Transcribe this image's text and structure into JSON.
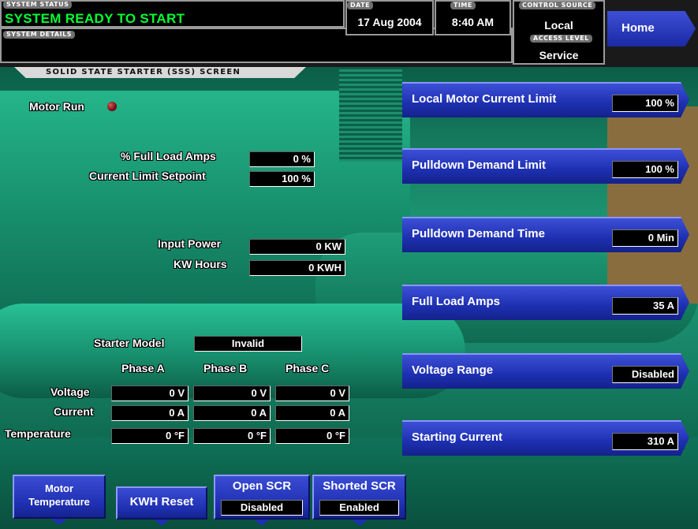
{
  "header": {
    "system_status_tag": "SYSTEM STATUS",
    "system_status": "SYSTEM READY TO START",
    "system_details_tag": "SYSTEM DETAILS",
    "system_details": "",
    "date_tag": "DATE",
    "date": "17 Aug 2004",
    "time_tag": "TIME",
    "time": "8:40 AM",
    "control_source_tag": "CONTROL SOURCE",
    "control_source": "Local",
    "access_level_tag": "ACCESS LEVEL",
    "access_level": "Service",
    "home_label": "Home"
  },
  "screen_title": "SOLID STATE STARTER (SSS) SCREEN",
  "motor_run": {
    "label": "Motor Run",
    "indicator_color": "#7a0c12"
  },
  "readings": {
    "full_load_amps_pct": {
      "label": "% Full Load Amps",
      "value": "0 %"
    },
    "current_limit_setpoint": {
      "label": "Current Limit Setpoint",
      "value": "100 %"
    },
    "input_power": {
      "label": "Input Power",
      "value": "0 KW"
    },
    "kw_hours": {
      "label": "KW Hours",
      "value": "0 KWH"
    },
    "starter_model": {
      "label": "Starter Model",
      "value": "Invalid"
    }
  },
  "phase_table": {
    "headers": [
      "Phase A",
      "Phase B",
      "Phase C"
    ],
    "rows": [
      {
        "label": "Voltage",
        "values": [
          "0 V",
          "0 V",
          "0 V"
        ]
      },
      {
        "label": "Current",
        "values": [
          "0 A",
          "0 A",
          "0 A"
        ]
      },
      {
        "label": "Temperature",
        "values": [
          "0 °F",
          "0 °F",
          "0 °F"
        ]
      }
    ]
  },
  "setpoints": [
    {
      "label": "Local Motor Current Limit",
      "value": "100 %"
    },
    {
      "label": "Pulldown Demand Limit",
      "value": "100 %"
    },
    {
      "label": "Pulldown Demand Time",
      "value": "0 Min"
    },
    {
      "label": "Full Load Amps",
      "value": "35 A"
    },
    {
      "label": "Voltage Range",
      "value": "Disabled"
    },
    {
      "label": "Starting Current",
      "value": "310 A"
    }
  ],
  "bottom_buttons": {
    "motor_temperature": {
      "line1": "Motor",
      "line2": "Temperature"
    },
    "kwh_reset": {
      "label": "KWH Reset"
    },
    "open_scr": {
      "label": "Open SCR",
      "value": "Disabled"
    },
    "shorted_scr": {
      "label": "Shorted SCR",
      "value": "Enabled"
    }
  },
  "colors": {
    "status_green": "#00ff33",
    "button_blue": "#1e2fb0",
    "motor_green": "#1f9f79"
  }
}
